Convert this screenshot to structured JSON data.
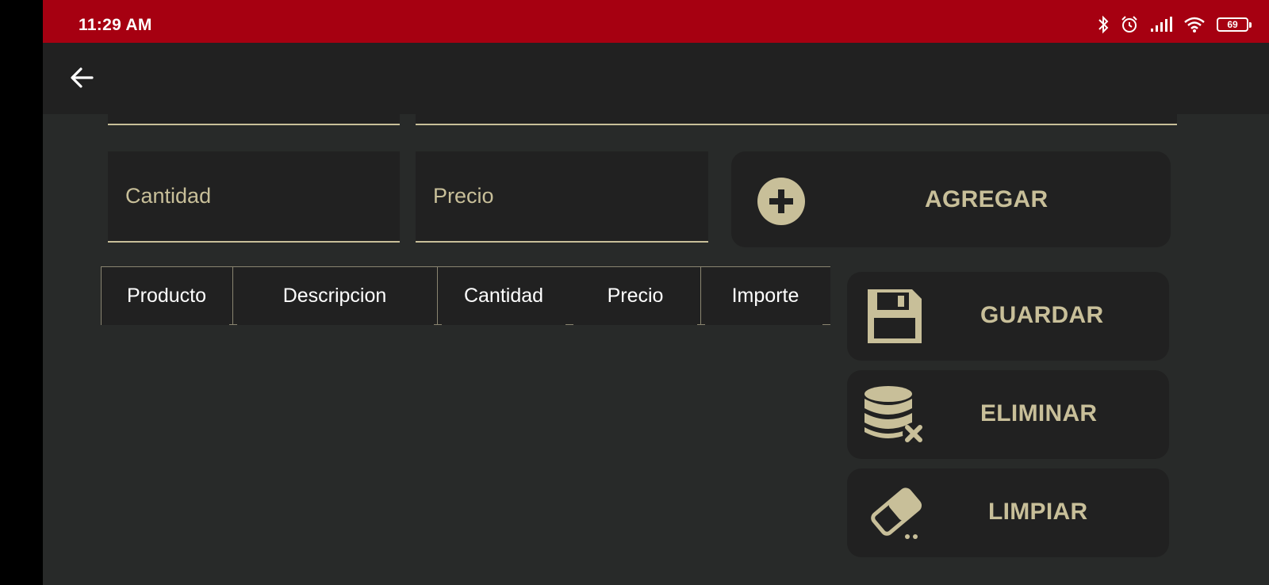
{
  "status_bar": {
    "time": "11:29 AM",
    "battery": "69",
    "icons": [
      "bluetooth-icon",
      "alarm-icon",
      "signal-icon",
      "wifi-icon",
      "battery-icon"
    ]
  },
  "app_bar": {
    "back_icon": "arrow-left-icon"
  },
  "form": {
    "cantidad_placeholder": "Cantidad",
    "precio_placeholder": "Precio",
    "cantidad_value": "",
    "precio_value": ""
  },
  "buttons": {
    "agregar": {
      "label": "AGREGAR",
      "icon": "plus-circle-icon"
    },
    "guardar": {
      "label": "GUARDAR",
      "icon": "floppy-disk-icon"
    },
    "eliminar": {
      "label": "ELIMINAR",
      "icon": "database-delete-icon"
    },
    "limpiar": {
      "label": "LIMPIAR",
      "icon": "eraser-icon"
    }
  },
  "table": {
    "columns": [
      "Producto",
      "Descripcion",
      "Cantidad",
      "Precio",
      "Importe"
    ],
    "rows": []
  },
  "colors": {
    "status_bar": "#a60011",
    "accent": "#c8bf99",
    "surface": "#212121",
    "background": "#282a29"
  }
}
